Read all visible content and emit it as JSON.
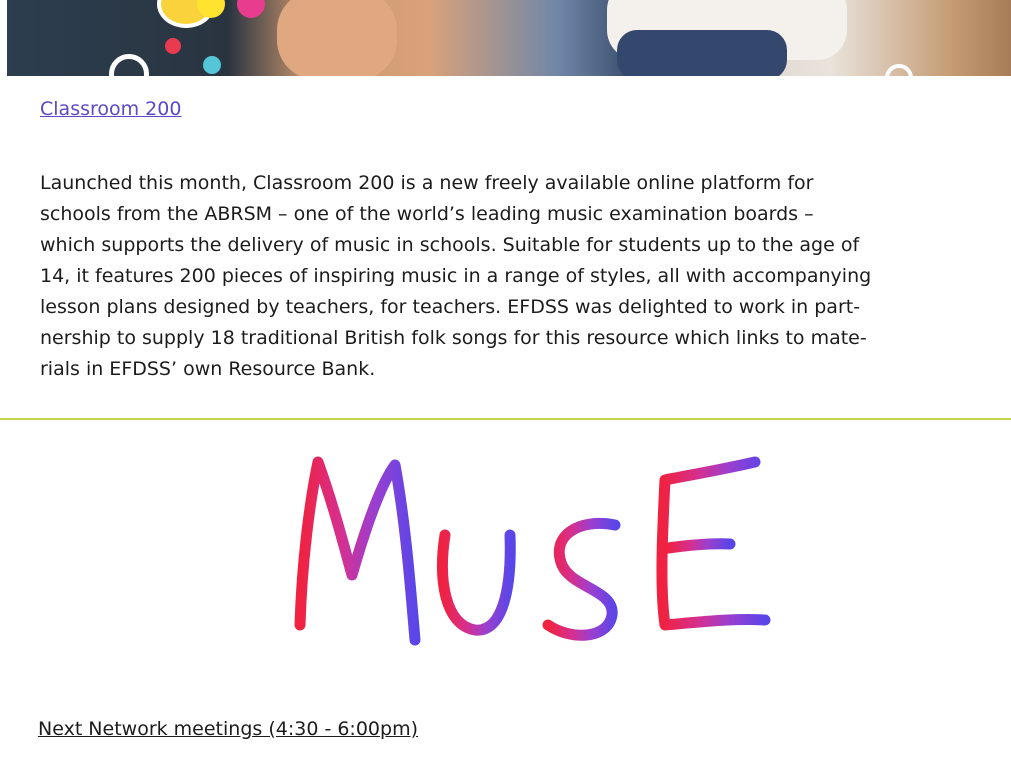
{
  "header_image": {
    "icon": "children-classroom-photo"
  },
  "article": {
    "link_title": "Classroom 200",
    "lines": [
      "Launched this month, Classroom 200 is a new freely available online platform for",
      "schools from the ABRSM – one of the world’s leading music examination boards –",
      "which supports the delivery of music in schools. Suitable for students up to the age of",
      "14, it features 200 pieces of inspiring music in a range of styles, all with accompanying",
      "lesson plans designed by teachers, for teachers. EFDSS was delighted to work in part-",
      "nership to supply 18 traditional British folk songs for this resource which links to mate-",
      "rials in EFDSS’ own Resource Bank."
    ]
  },
  "logo": {
    "text": "MUSE",
    "colors": [
      "#f0223f",
      "#d62f8e",
      "#9b3fd0",
      "#5a46e8"
    ]
  },
  "colors": {
    "link": "#5a49c8",
    "divider": "#c6d64a",
    "text": "#1c1c1c"
  },
  "next_section": {
    "heading": "Next Network meetings (4:30 - 6:00pm)"
  }
}
